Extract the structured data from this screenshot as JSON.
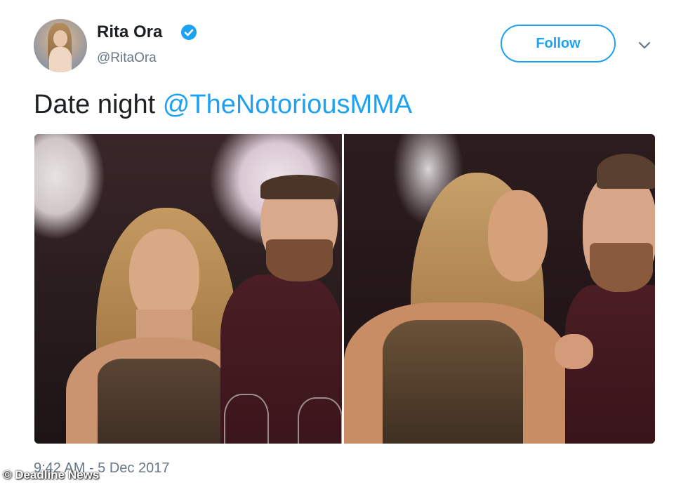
{
  "user": {
    "name": "Rita Ora",
    "handle": "@RitaOra",
    "verified": true,
    "avatar_icon": "profile-photo"
  },
  "actions": {
    "follow_label": "Follow",
    "menu_icon": "chevron-down-icon"
  },
  "tweet": {
    "text": "Date night ",
    "mention": "@TheNotoriousMMA"
  },
  "media": {
    "photos": [
      "photo-left",
      "photo-right"
    ]
  },
  "meta": {
    "timestamp": "9:42 AM - 5 Dec 2017",
    "watermark": "© Deadline News"
  },
  "colors": {
    "accent": "#1da1f2",
    "text": "#1c2022",
    "secondary": "#657786"
  }
}
